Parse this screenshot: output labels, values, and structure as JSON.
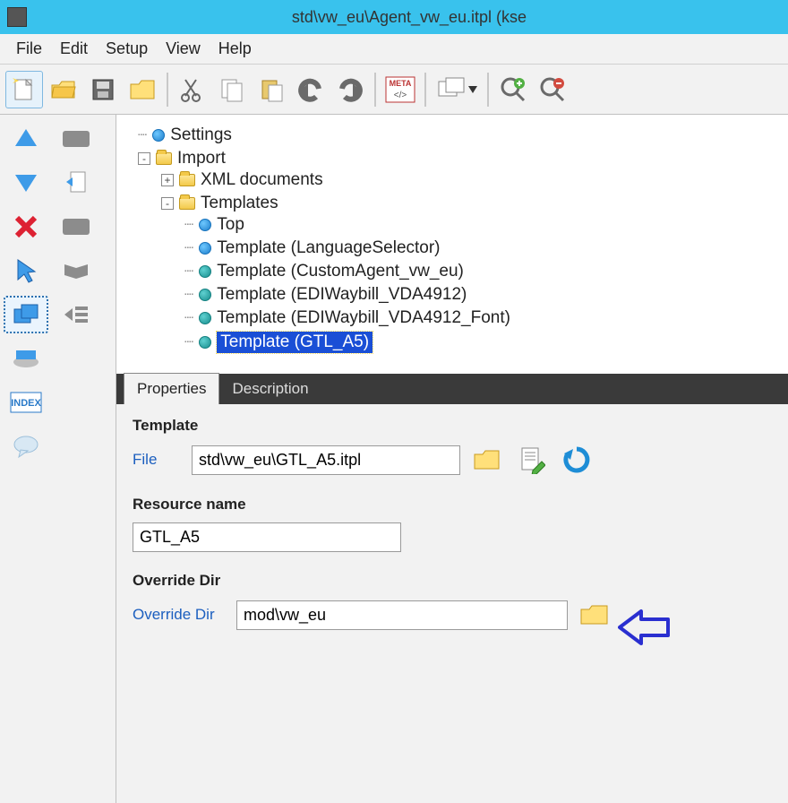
{
  "titlebar": {
    "title": "std\\vw_eu\\Agent_vw_eu.itpl (kse"
  },
  "menubar": {
    "file": "File",
    "edit": "Edit",
    "setup": "Setup",
    "view": "View",
    "help": "Help"
  },
  "toolbar": {
    "meta_label": "META"
  },
  "tree": {
    "settings": "Settings",
    "import": "Import",
    "xmldocs": "XML documents",
    "templates": "Templates",
    "items": [
      "Top",
      "Template (LanguageSelector)",
      "Template (CustomAgent_vw_eu)",
      "Template (EDIWaybill_VDA4912)",
      "Template (EDIWaybill_VDA4912_Font)",
      "Template (GTL_A5)"
    ]
  },
  "tabs": {
    "properties": "Properties",
    "description": "Description"
  },
  "panel": {
    "template_heading": "Template",
    "file_label": "File",
    "file_value": "std\\vw_eu\\GTL_A5.itpl",
    "resource_heading": "Resource name",
    "resource_value": "GTL_A5",
    "override_heading": "Override Dir",
    "override_label": "Override Dir",
    "override_value": "mod\\vw_eu"
  }
}
